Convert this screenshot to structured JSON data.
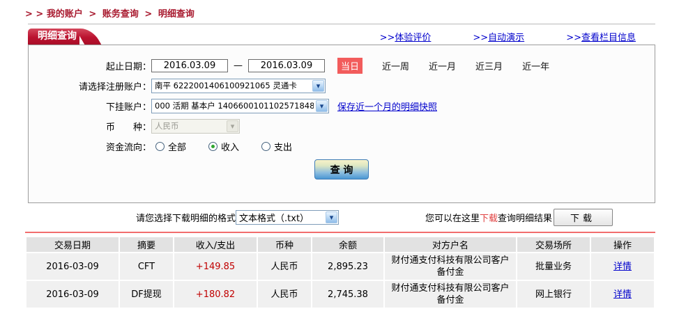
{
  "colors": {
    "brand_red": "#bb1330",
    "breadcrumb_red": "#a8192e",
    "badge_red": "#f25c5c",
    "divider_red": "#f26d6d",
    "link_blue": "#0000cc",
    "amount_red": "#c00000"
  },
  "breadcrumb": {
    "prefix": "> >",
    "separator": ">",
    "items": [
      "我的账户",
      "账务查询",
      "明细查询"
    ]
  },
  "tab_title": "明细查询",
  "top_links": [
    {
      "prefix": ">>",
      "label": "体验评价"
    },
    {
      "prefix": ">>",
      "label": "自动演示"
    },
    {
      "prefix": ">>",
      "label": "查看栏目信息"
    }
  ],
  "form": {
    "date_range": {
      "label": "起止日期：",
      "start": "2016.03.09",
      "end": "2016.03.09",
      "dash": "—",
      "quick_current": "当日",
      "quick_links": [
        "近一周",
        "近一月",
        "近三月",
        "近一年"
      ]
    },
    "account": {
      "label": "请选择注册账户：",
      "value": "南平  6222001406100921065  灵通卡"
    },
    "sub_account": {
      "label": "下挂账户：",
      "value": "000  活期  基本户  1406600101102571848",
      "snapshot_link": "保存近一个月的明细快照"
    },
    "currency": {
      "label": "币　　种：",
      "value": "人民币"
    },
    "flow": {
      "label": "资金流向：",
      "options": [
        {
          "label": "全部",
          "checked": false
        },
        {
          "label": "收入",
          "checked": true
        },
        {
          "label": "支出",
          "checked": false
        }
      ]
    },
    "query_button": "查 询"
  },
  "download": {
    "format_label": "请您选择下载明细的格式",
    "format_value": "文本格式（.txt）",
    "hint_prefix": "您可以在这里",
    "hint_download": "下载",
    "hint_suffix": "查询明细结果",
    "button": "下载"
  },
  "table": {
    "headers": [
      "交易日期",
      "摘要",
      "收入/支出",
      "币种",
      "余额",
      "对方户名",
      "交易场所",
      "操作"
    ],
    "rows": [
      {
        "date": "2016-03-09",
        "summary": "CFT",
        "amount": "+149.85",
        "currency": "人民币",
        "balance": "2,895.23",
        "counterparty": "财付通支付科技有限公司客户备付金",
        "channel": "批量业务",
        "action": "详情"
      },
      {
        "date": "2016-03-09",
        "summary": "DF提现",
        "amount": "+180.82",
        "currency": "人民币",
        "balance": "2,745.38",
        "counterparty": "财付通支付科技有限公司客户备付金",
        "channel": "网上银行",
        "action": "详情"
      }
    ]
  }
}
